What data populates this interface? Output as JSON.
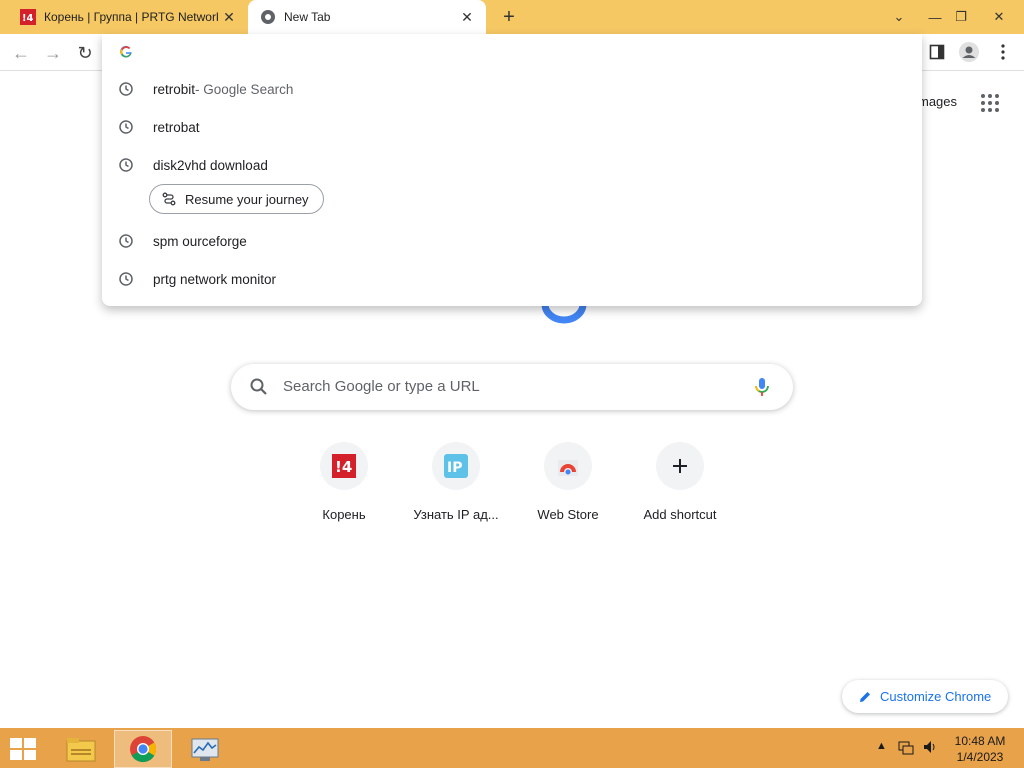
{
  "tabs": [
    {
      "title": "Корень | Группа | PRTG Network",
      "active": false,
      "favicon": "prtg-icon"
    },
    {
      "title": "New Tab",
      "active": true,
      "favicon": "chrome-icon"
    }
  ],
  "omnibox": {
    "value": "",
    "suggestions": [
      {
        "text": "retrobit",
        "desc": " - Google Search"
      },
      {
        "text": "retrobat",
        "desc": ""
      },
      {
        "text": "disk2vhd download",
        "desc": ""
      },
      {
        "text": "spm ourceforge",
        "desc": ""
      },
      {
        "text": "prtg network monitor",
        "desc": ""
      }
    ],
    "journey_chip": "Resume your journey"
  },
  "header": {
    "images_label": "mages"
  },
  "search": {
    "placeholder": "Search Google or type a URL"
  },
  "shortcuts": [
    {
      "label": "Корень",
      "icon": "prtg-icon"
    },
    {
      "label": "Узнать IP ад...",
      "icon": "ip-icon"
    },
    {
      "label": "Web Store",
      "icon": "web-store-icon"
    },
    {
      "label": "Add shortcut",
      "icon": "plus-icon"
    }
  ],
  "customize": {
    "label": "Customize Chrome"
  },
  "taskbar": {
    "time": "10:48 AM",
    "date": "1/4/2023"
  },
  "colors": {
    "tab_strip": "#f5c864",
    "taskbar": "#e8a24a",
    "accent": "#1a73e8"
  }
}
